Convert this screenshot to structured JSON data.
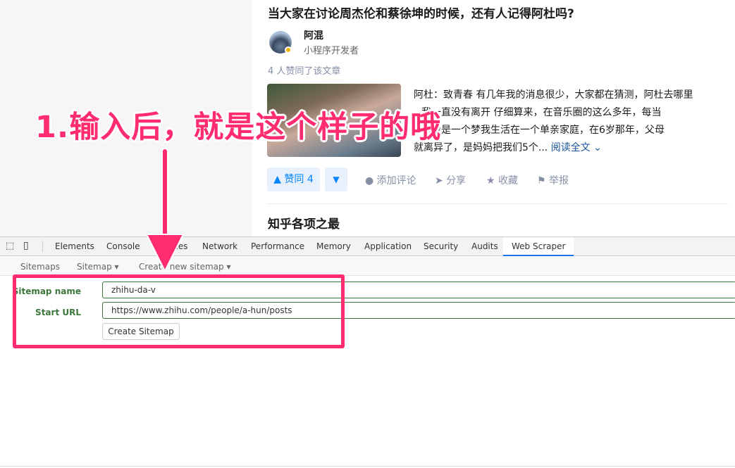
{
  "article": {
    "title": "当大家在讨论周杰伦和蔡徐坤的时候，还有人记得阿杜吗?",
    "author": {
      "name": "阿混",
      "headline": "小程序开发者"
    },
    "votes_text": "4 人赞同了该文章",
    "excerpt_lines": [
      "阿杜：致青春 有几年我的消息很少，大家都在猜测，阿杜去哪里",
      "我一直没有离开 仔细算来，在音乐圈的这么多年，每当",
      "然像是一个梦我生活在一个单亲家庭，在6岁那年，父母",
      "就离异了，是妈妈把我们5个..."
    ],
    "read_more": "阅读全文 ⌄",
    "upvote": "▲ 赞同 4",
    "downvote": "▼",
    "actions": [
      {
        "icon": "comment-icon",
        "glyph": "●",
        "label": "添加评论"
      },
      {
        "icon": "share-icon",
        "glyph": "➤",
        "label": "分享"
      },
      {
        "icon": "star-icon",
        "glyph": "★",
        "label": "收藏"
      },
      {
        "icon": "flag-icon",
        "glyph": "⚑",
        "label": "举报"
      }
    ],
    "next_title": "知乎各项之最"
  },
  "devtools": {
    "tabs": [
      "Elements",
      "Console",
      "Sources",
      "Network",
      "Performance",
      "Memory",
      "Application",
      "Security",
      "Audits",
      "Web Scraper"
    ],
    "active_tab": "Web Scraper",
    "subnav": [
      "Sitemaps",
      "Sitemap ▾",
      "Create new sitemap ▾"
    ],
    "form": {
      "sitemap_name_label": "Sitemap name",
      "sitemap_name_value": "zhihu-da-v",
      "start_url_label": "Start URL",
      "start_url_value": "https://www.zhihu.com/people/a-hun/posts",
      "create_button": "Create Sitemap"
    }
  },
  "annotation": {
    "text": "1.输入后，就是这个样子的哦",
    "color": "#ff2d6f"
  }
}
